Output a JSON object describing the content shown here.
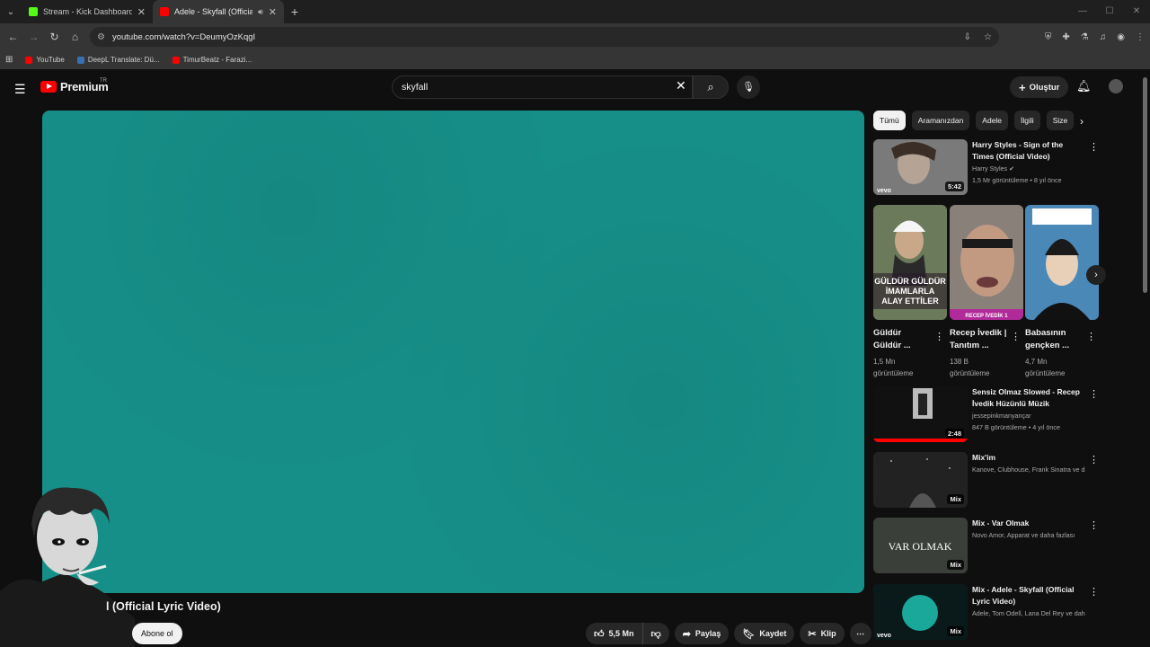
{
  "browser": {
    "tabs": [
      {
        "title": "Stream - Kick Dashboard",
        "favicon_color": "#53fc18"
      },
      {
        "title": "Adele - Skyfall (Official Lyri",
        "favicon_color": "#ff0000"
      }
    ],
    "url": "youtube.com/watch?v=DeumyOzKqgI",
    "bookmarks": [
      {
        "label": "YouTube",
        "color": "#ff0000"
      },
      {
        "label": "DeepL Translate: Dü...",
        "color": "#0f2b46"
      },
      {
        "label": "TimurBeatz - Farazi...",
        "color": "#ff0000"
      }
    ]
  },
  "header": {
    "logo": "Premium",
    "country": "TR",
    "search_value": "skyfall",
    "create_label": "Oluştur"
  },
  "video": {
    "title_visible": "l (Official Lyric Video)",
    "subscribe_label": "Abone ol",
    "likes": "5,5 Mn",
    "share_label": "Paylaş",
    "save_label": "Kaydet",
    "clip_label": "Klip",
    "player_color": "#168f88"
  },
  "sidebar": {
    "chips": [
      "Tümü",
      "Aramanızdan",
      "Adele",
      "İlgili",
      "Size"
    ],
    "videos": [
      {
        "title": "Harry Styles - Sign of the Times (Official Video)",
        "channel": "Harry Styles",
        "meta": "1,5 Mr görüntüleme • 8 yıl önce",
        "badge": "5:42",
        "thumb_color": "#6b6b6b"
      },
      {
        "title": "Sensiz Olmaz Slowed - Recep İvedik Hüzünlü Müzik",
        "channel": "jessepinkmanyançar",
        "meta": "847 B görüntüleme • 4 yıl önce",
        "badge": "2:48",
        "thumb_color": "#1a1a1a"
      },
      {
        "title": "Mix'im",
        "channel": "Kanove, Clubhouse, Frank Sinatra ve dah...",
        "meta": "",
        "badge": "Mix",
        "thumb_color": "#2a2a2a"
      },
      {
        "title": "Mix - Var Olmak",
        "channel": "Novo Amor, Apparat ve daha fazlası",
        "meta": "",
        "badge": "Mix",
        "thumb_color": "#3a3f3a",
        "thumb_text": "VAR OLMAK"
      },
      {
        "title": "Mix - Adele - Skyfall (Official Lyric Video)",
        "channel": "Adele, Tom Odell, Lana Del Rey ve daha f...",
        "meta": "",
        "badge": "Mix",
        "thumb_color": "#0a2a2a"
      }
    ],
    "shorts": [
      {
        "title": "Güldür Güldür ...",
        "views": "1,5 Mn",
        "views_label": "görüntüleme",
        "thumb_text": "GÜLDÜR GÜLDÜR İMAMLARLA ALAY ETTİLER",
        "thumb_color": "#5a6b4a"
      },
      {
        "title": "Recep İvedik | Tanıtım ...",
        "views": "138 B",
        "views_label": "görüntüleme",
        "thumb_text": "RECEP İVEDİK 1",
        "thumb_color": "#7a6f6a"
      },
      {
        "title": "Babasının gençken ...",
        "views": "4,7 Mn",
        "views_label": "görüntüleme",
        "thumb_text": "",
        "thumb_color": "#4a88b8"
      }
    ]
  }
}
